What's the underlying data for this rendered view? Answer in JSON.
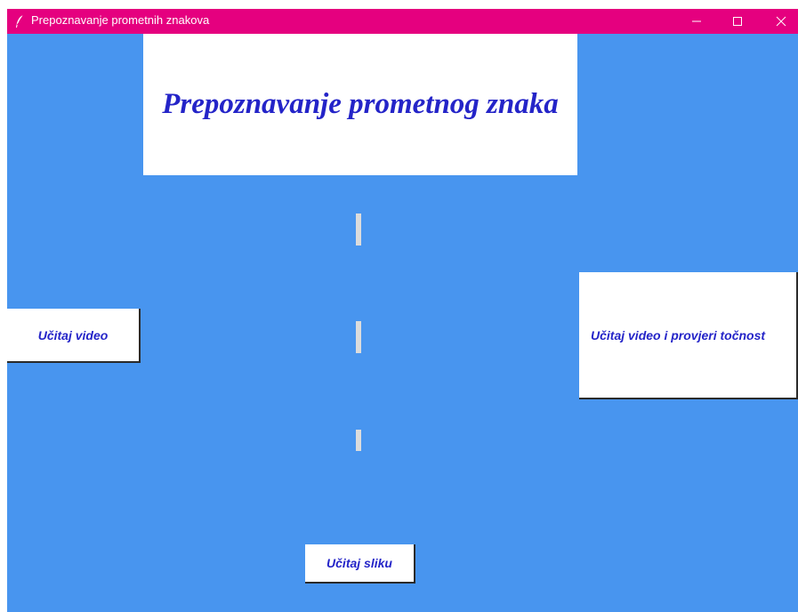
{
  "window": {
    "title": "Prepoznavanje prometnih znakova",
    "icon": "feather-icon",
    "titlebar_color": "#e5007f",
    "background_color": "#4895ef",
    "controls": [
      "minimize-icon",
      "maximize-icon",
      "close-icon"
    ]
  },
  "header": {
    "title": "Prepoznavanje prometnog znaka",
    "text_color": "#2424c8"
  },
  "buttons": {
    "load_video": "Učitaj video",
    "load_video_check_accuracy": "Učitaj video i provjeri točnost",
    "load_image": "Učitaj sliku"
  }
}
